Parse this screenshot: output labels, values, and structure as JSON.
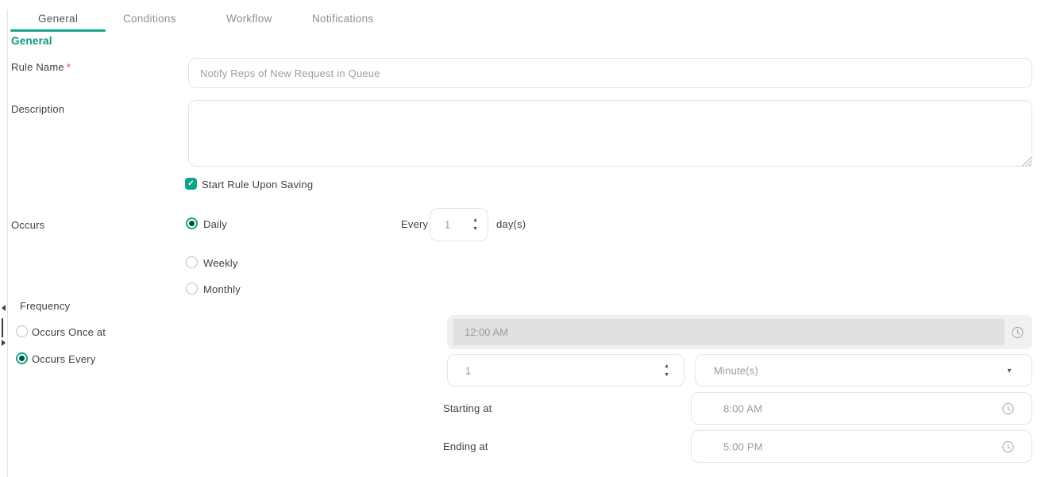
{
  "colors": {
    "accent": "#12A38C",
    "heading": "#0E9384",
    "required_asterisk": "#EF3B36",
    "disabled_field_bg": "#E0E0E0"
  },
  "tabs": {
    "items": [
      {
        "label": "General",
        "active": true
      },
      {
        "label": "Conditions",
        "active": false
      },
      {
        "label": "Workflow",
        "active": false
      },
      {
        "label": "Notifications",
        "active": false
      }
    ]
  },
  "section": {
    "title": "General"
  },
  "fields": {
    "rule_name": {
      "label": "Rule Name",
      "required_marker": "*",
      "placeholder": "Notify Reps of New Request in Queue",
      "value": ""
    },
    "description": {
      "label": "Description",
      "value": ""
    },
    "start_rule": {
      "label": "Start Rule Upon Saving",
      "checked": true
    },
    "occurs": {
      "label": "Occurs",
      "options": [
        {
          "label": "Daily",
          "selected": true
        },
        {
          "label": "Weekly",
          "selected": false
        },
        {
          "label": "Monthly",
          "selected": false
        }
      ],
      "daily_interval": {
        "prefix": "Every",
        "value": "1",
        "suffix": "day(s)"
      }
    },
    "frequency": {
      "label": "Frequency",
      "once": {
        "label": "Occurs Once at",
        "selected": false,
        "time_value": "12:00 AM",
        "disabled": true
      },
      "every": {
        "label": "Occurs Every",
        "selected": true,
        "interval_value": "1",
        "unit_value": "Minute(s)"
      },
      "starting_at": {
        "label": "Starting at",
        "value": "8:00 AM"
      },
      "ending_at": {
        "label": "Ending at",
        "value": "5:00 PM"
      }
    }
  },
  "icons": {
    "stepper_up": "▲",
    "stepper_down": "▼",
    "select_caret": "▼",
    "checkbox_check": "✓"
  }
}
